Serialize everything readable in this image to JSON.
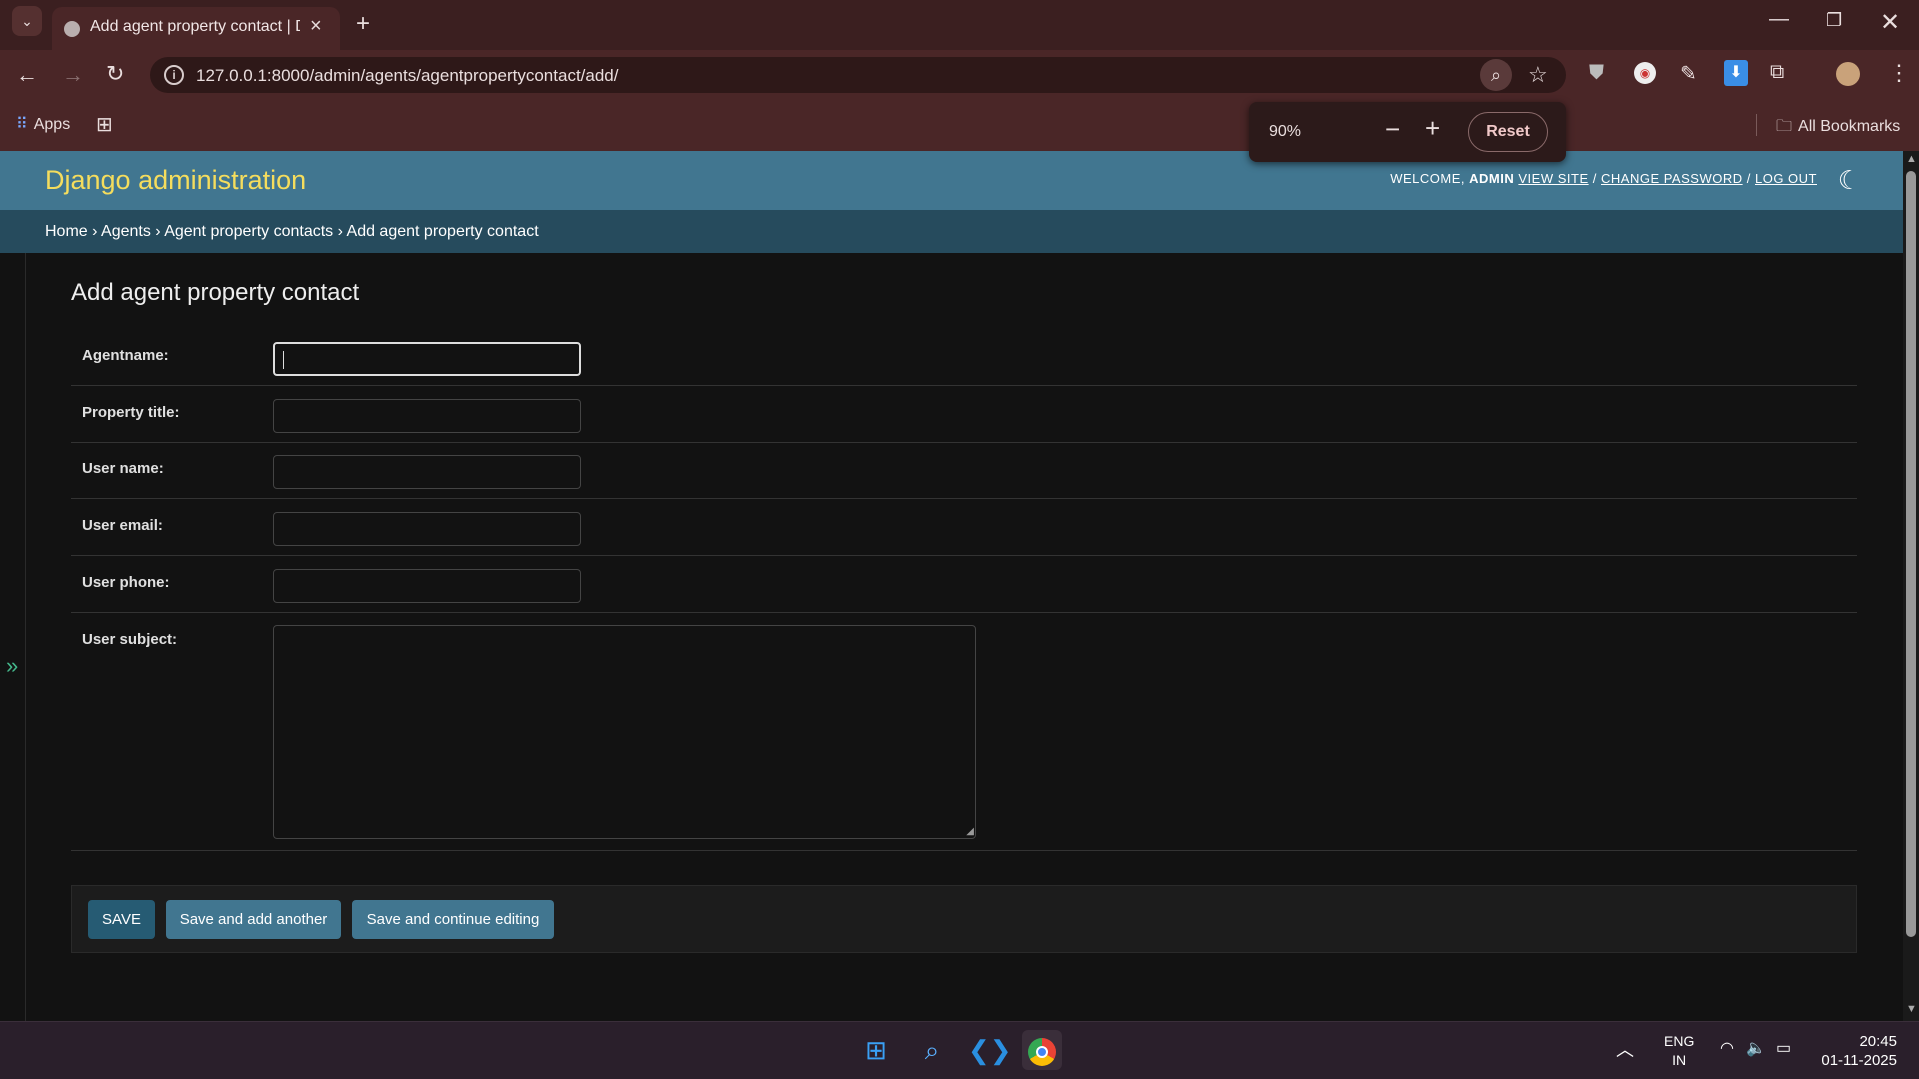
{
  "browser": {
    "tab_title": "Add agent property contact | Dj",
    "url": "127.0.0.1:8000/admin/agents/agentpropertycontact/add/",
    "bookmarks": {
      "apps_label": "Apps",
      "all_bookmarks_label": "All Bookmarks"
    },
    "zoom_popup": {
      "level": "90%",
      "reset_label": "Reset"
    }
  },
  "django": {
    "brand": "Django administration",
    "user_tools": {
      "welcome": "WELCOME,",
      "user": "ADMIN",
      "separator": ".",
      "view_site": "VIEW SITE",
      "slash1": "/",
      "change_password": "CHANGE PASSWORD",
      "slash2": "/",
      "log_out": "LOG OUT"
    },
    "breadcrumbs": {
      "home": "Home",
      "sep": "›",
      "agents": "Agents",
      "model": "Agent property contacts",
      "current": "Add agent property contact"
    },
    "nav_toggle": "»"
  },
  "form": {
    "title": "Add agent property contact",
    "fields": [
      {
        "label": "Agentname:",
        "value": ""
      },
      {
        "label": "Property title:",
        "value": ""
      },
      {
        "label": "User name:",
        "value": ""
      },
      {
        "label": "User email:",
        "value": ""
      },
      {
        "label": "User phone:",
        "value": ""
      },
      {
        "label": "User subject:",
        "value": ""
      }
    ],
    "buttons": {
      "save": "SAVE",
      "save_add_another": "Save and add another",
      "save_continue": "Save and continue editing"
    }
  },
  "taskbar": {
    "language": "ENG",
    "region": "IN",
    "time": "20:45",
    "date": "01-11-2025"
  },
  "colors": {
    "django_header": "#417690",
    "breadcrumbs": "#264b5d",
    "brand_text": "#f5dd5d",
    "save_button": "#265b73",
    "other_buttons": "#417690"
  }
}
